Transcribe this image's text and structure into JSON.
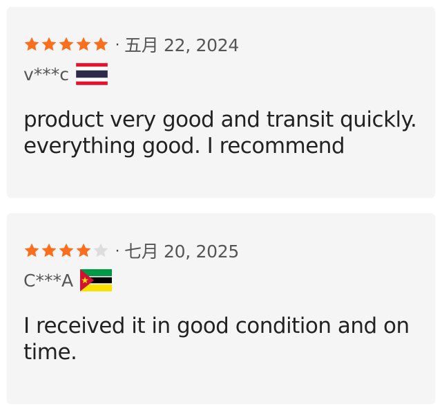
{
  "colors": {
    "star_filled": "#fa6e1e",
    "star_empty": "#dddddd",
    "card_bg": "#f5f5f5",
    "text_primary": "#222222",
    "text_secondary": "#555555"
  },
  "reviews": [
    {
      "rating": 5,
      "max_rating": 5,
      "separator": "·",
      "date": "五月 22, 2024",
      "user": "v***c",
      "flag_icon": "thailand-flag-icon",
      "text": "product very good and transit quickly. everything good. I recommend"
    },
    {
      "rating": 4,
      "max_rating": 5,
      "separator": "·",
      "date": "七月 20, 2025",
      "user": "C***A",
      "flag_icon": "mozambique-flag-icon",
      "text": "I received it in good condition and on time."
    }
  ]
}
